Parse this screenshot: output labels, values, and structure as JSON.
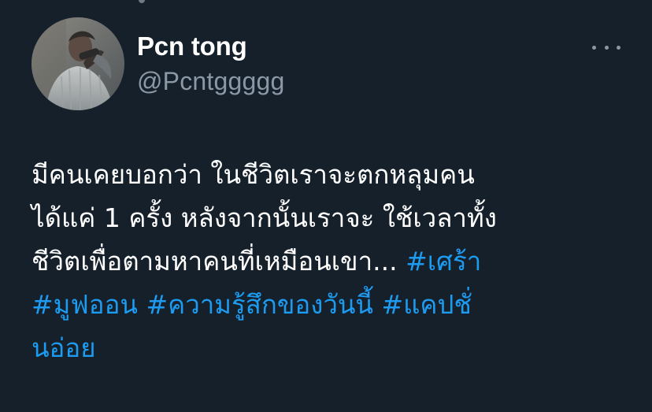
{
  "user": {
    "display_name": "Pcn tong",
    "handle": "@Pcntggggg",
    "avatar_icon": "profile-photo"
  },
  "menu": {
    "icon": "more-horizontal-icon"
  },
  "tweet": {
    "lines": [
      {
        "text": "มีคนเคยบอกว่า  ในชีวิตเราจะตกหลุมคน"
      },
      {
        "text": "ได้แค่ 1 ครั้ง หลังจากนั้นเราจะ ใช้เวลาทั้ง"
      },
      {
        "text": "ชีวิตเพื่อตามหาคนที่เหมือนเขา... ",
        "hashtag": "#เศร้า"
      }
    ],
    "hashtags": [
      "#มูฟออน",
      "#ความรู้สึกของวันนี้",
      "#แคปชั่",
      "นอ่อย"
    ]
  },
  "colors": {
    "background": "#15202b",
    "text": "#ffffff",
    "secondary_text": "#8b98a5",
    "hashtag": "#1d9bf0"
  }
}
